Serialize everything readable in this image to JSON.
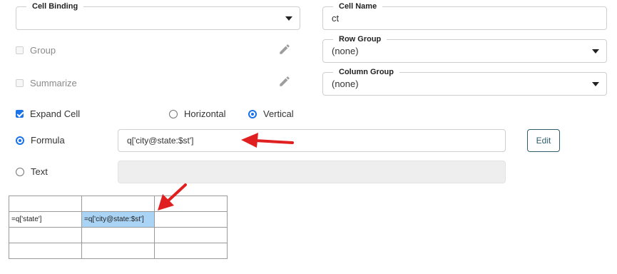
{
  "cell_binding": {
    "label": "Cell Binding",
    "value": ""
  },
  "cell_name": {
    "label": "Cell Name",
    "value": "ct"
  },
  "group": {
    "label": "Group",
    "checked": false,
    "disabled": true
  },
  "summarize": {
    "label": "Summarize",
    "checked": false,
    "disabled": true
  },
  "row_group": {
    "label": "Row Group",
    "value": "(none)"
  },
  "column_group": {
    "label": "Column Group",
    "value": "(none)"
  },
  "expand_cell": {
    "label": "Expand Cell",
    "checked": true
  },
  "orientation": {
    "horizontal_label": "Horizontal",
    "vertical_label": "Vertical",
    "selected": "Vertical"
  },
  "formula": {
    "label": "Formula",
    "value": "q['city@state:$st']",
    "selected": true
  },
  "text": {
    "label": "Text",
    "value": "",
    "selected": false
  },
  "edit_button": {
    "label": "Edit"
  },
  "grid": {
    "rows": [
      [
        "",
        "",
        ""
      ],
      [
        "=q['state']",
        "=q['city@state:$st']",
        ""
      ],
      [
        "",
        "",
        ""
      ],
      [
        "",
        "",
        ""
      ]
    ]
  },
  "icons": {
    "pencil": "pencil-icon",
    "caret": "chevron-down-icon",
    "arrow": "red-arrow-annotation"
  },
  "colors": {
    "accent": "#1a73e8",
    "arrow": "#e02020",
    "selected_cell": "#aad4f5"
  }
}
